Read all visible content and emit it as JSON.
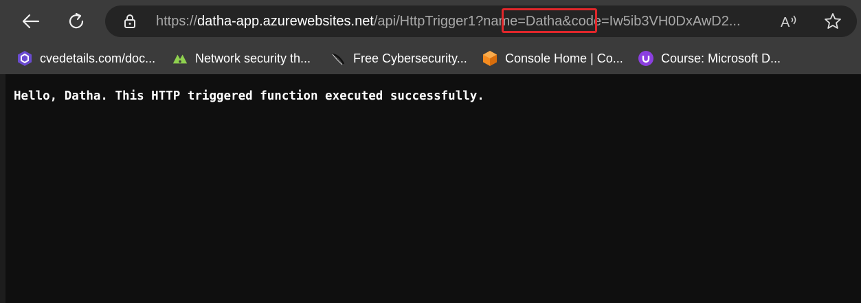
{
  "browser": {
    "url_prefix": "https://",
    "url_host": "datha-app.azurewebsites.net",
    "url_path": "/api/HttpTrigger1?name=Datha&code=Iw5ib3VH0DxAwD2...",
    "highlight_color": "#e0272b"
  },
  "bookmarks": [
    {
      "label": "cvedetails.com/doc...",
      "icon": "cvedetails-icon"
    },
    {
      "label": "Network security th...",
      "icon": "network-security-icon"
    },
    {
      "label": "Free Cybersecurity...",
      "icon": "cybersecurity-icon"
    },
    {
      "label": "Console Home | Co...",
      "icon": "aws-console-icon"
    },
    {
      "label": "Course: Microsoft D...",
      "icon": "course-icon"
    }
  ],
  "page": {
    "message": "Hello, Datha. This HTTP triggered function executed successfully."
  }
}
